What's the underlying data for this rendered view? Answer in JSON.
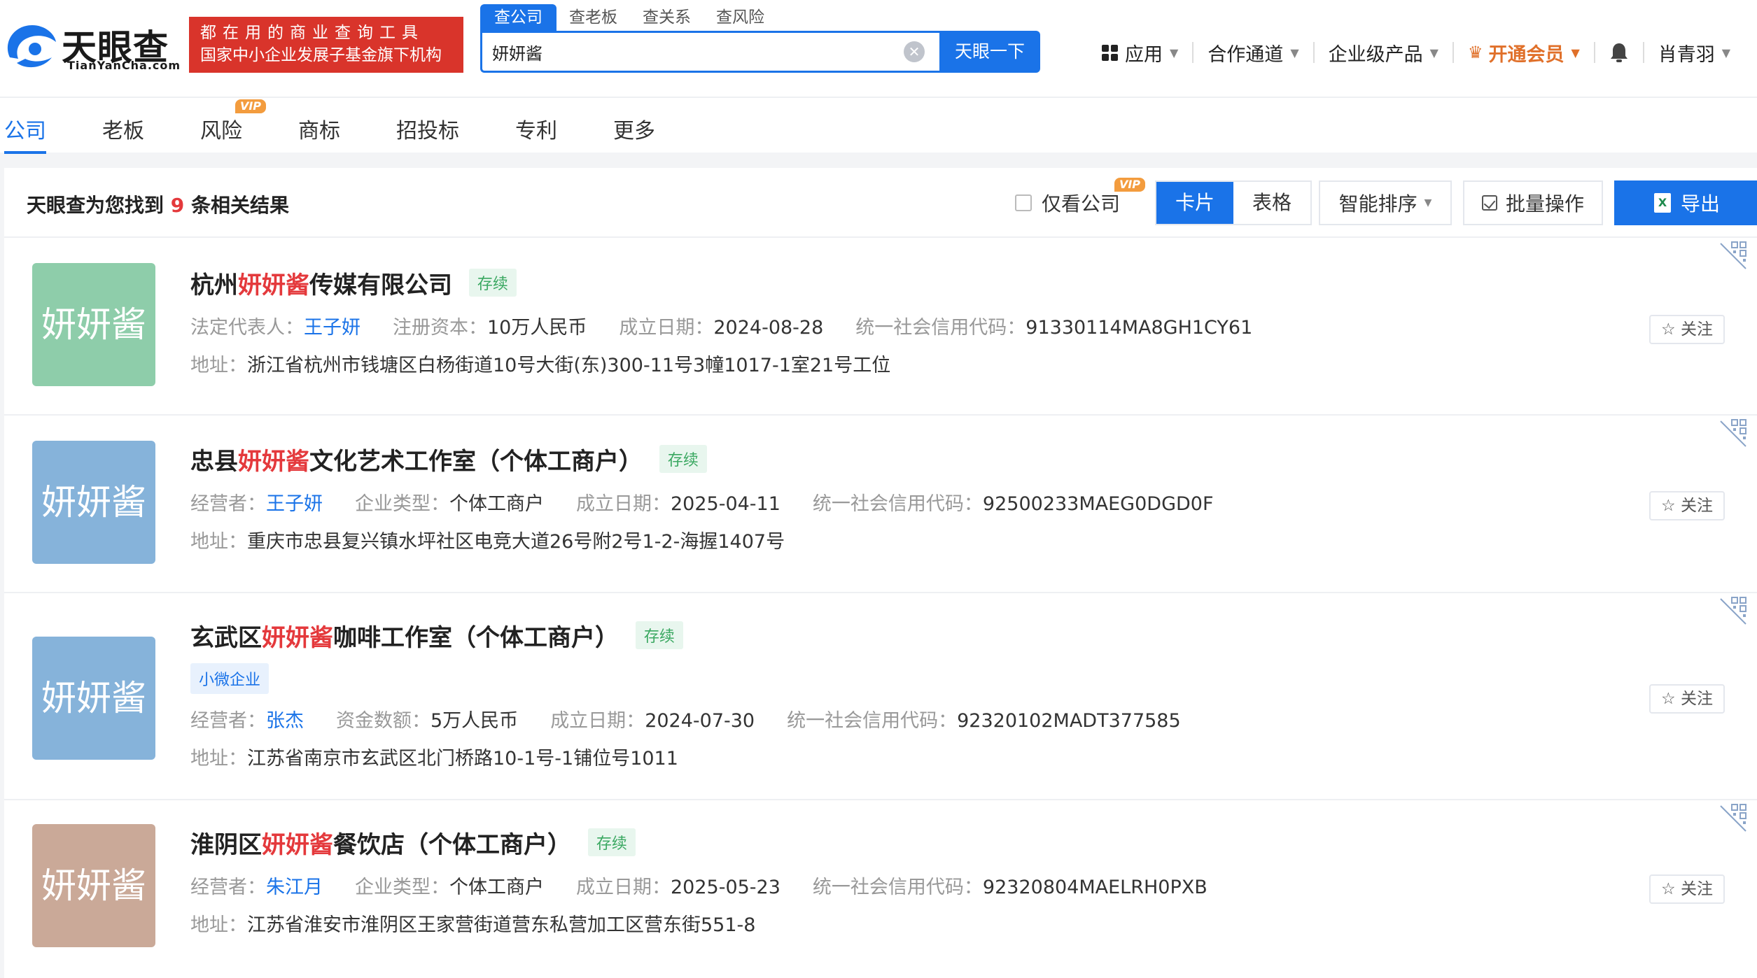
{
  "brand": {
    "name_cn": "天眼查",
    "name_en": "TianYanCha.com",
    "slogan_line1": "都在用的商业查询工具",
    "slogan_line2": "国家中小企业发展子基金旗下机构"
  },
  "search": {
    "tabs": [
      "查公司",
      "查老板",
      "查关系",
      "查风险"
    ],
    "active_tab": 0,
    "query": "妍妍酱",
    "clear_icon": "clear-icon",
    "button_label": "天眼一下"
  },
  "topnav": {
    "apps": "应用",
    "channel": "合作通道",
    "enterprise": "企业级产品",
    "vip": "开通会员",
    "user": "肖青羽"
  },
  "category_tabs": [
    "公司",
    "老板",
    "风险",
    "商标",
    "招投标",
    "专利",
    "更多"
  ],
  "vip_badge": "VIP",
  "results_head": {
    "prefix": "天眼查为您找到",
    "count": "9",
    "suffix": "条相关结果",
    "only_company": "仅看公司",
    "view_card": "卡片",
    "view_table": "表格",
    "sort": "智能排序",
    "batch": "批量操作",
    "export": "导出"
  },
  "follow_label": "关注",
  "results": [
    {
      "avatar_text": "妍妍酱",
      "avatar_color": "#8ecdaa",
      "name_pre": "杭州",
      "name_hl": "妍妍酱",
      "name_post": "传媒有限公司",
      "status": "存续",
      "person_label": "法定代表人：",
      "person": "王子妍",
      "f2_label": "注册资本：",
      "f2": "10万人民币",
      "f3_label": "成立日期：",
      "f3": "2024-08-28",
      "f4_label": "统一社会信用代码：",
      "f4": "91330114MA8GH1CY61",
      "addr_label": "地址：",
      "addr": "浙江省杭州市钱塘区白杨街道10号大街(东)300-11号3幢1017-1室21号工位"
    },
    {
      "avatar_text": "妍妍酱",
      "avatar_color": "#86b3da",
      "name_pre": "忠县",
      "name_hl": "妍妍酱",
      "name_post": "文化艺术工作室（个体工商户）",
      "status": "存续",
      "person_label": "经营者：",
      "person": "王子妍",
      "f2_label": "企业类型：",
      "f2": "个体工商户",
      "f3_label": "成立日期：",
      "f3": "2025-04-11",
      "f4_label": "统一社会信用代码：",
      "f4": "92500233MAEG0DGD0F",
      "addr_label": "地址：",
      "addr": "重庆市忠县复兴镇水坪社区电竞大道26号附2号1-2-海握1407号"
    },
    {
      "avatar_text": "妍妍酱",
      "avatar_color": "#86b3da",
      "name_pre": "玄武区",
      "name_hl": "妍妍酱",
      "name_post": "咖啡工作室（个体工商户）",
      "status": "存续",
      "tag": "小微企业",
      "person_label": "经营者：",
      "person": "张杰",
      "f2_label": "资金数额：",
      "f2": "5万人民币",
      "f3_label": "成立日期：",
      "f3": "2024-07-30",
      "f4_label": "统一社会信用代码：",
      "f4": "92320102MADT377585",
      "addr_label": "地址：",
      "addr": "江苏省南京市玄武区北门桥路10-1号-1铺位号1011"
    },
    {
      "avatar_text": "妍妍酱",
      "avatar_color": "#caa998",
      "name_pre": "淮阴区",
      "name_hl": "妍妍酱",
      "name_post": "餐饮店（个体工商户）",
      "status": "存续",
      "person_label": "经营者：",
      "person": "朱江月",
      "f2_label": "企业类型：",
      "f2": "个体工商户",
      "f3_label": "成立日期：",
      "f3": "2025-05-23",
      "f4_label": "统一社会信用代码：",
      "f4": "92320804MAELRH0PXB",
      "addr_label": "地址：",
      "addr": "江苏省淮安市淮阴区王家营街道营东私营加工区营东街551-8"
    }
  ]
}
